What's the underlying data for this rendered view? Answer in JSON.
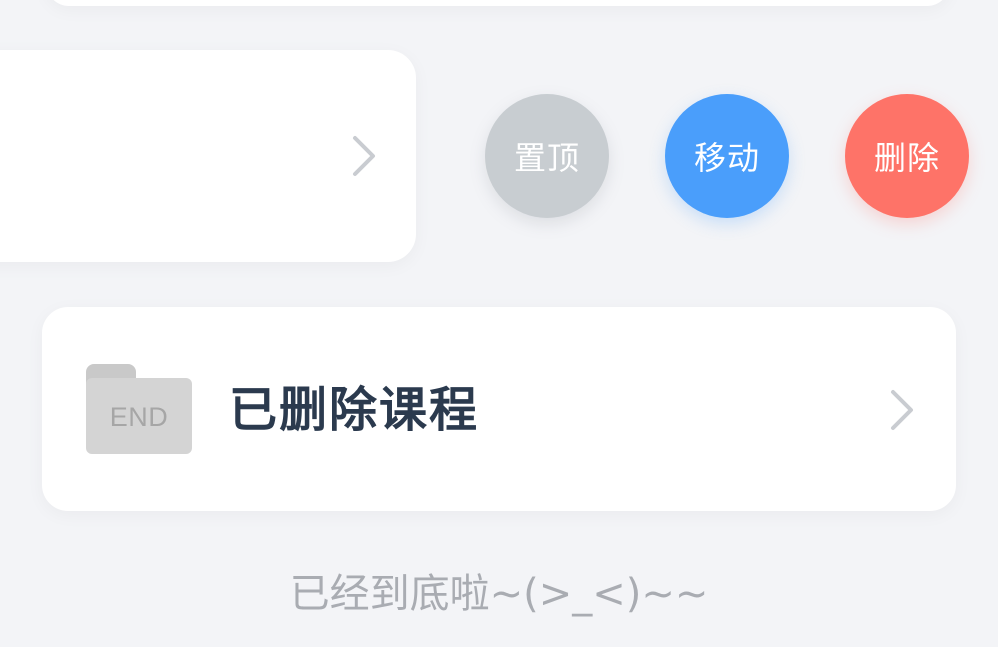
{
  "swiped_item": {
    "actions": [
      {
        "label": "置顶",
        "color": "#c8cdd1"
      },
      {
        "label": "移动",
        "color": "#4a9efb"
      },
      {
        "label": "删除",
        "color": "#fe7368"
      }
    ]
  },
  "deleted_folder": {
    "icon": "folder-icon",
    "icon_label": "END",
    "title": "已删除课程"
  },
  "footer": {
    "end_text": "已经到底啦~(>_<)~~"
  },
  "colors": {
    "background": "#f3f4f7",
    "card": "#ffffff",
    "title": "#2b3a4e",
    "footer": "#a9acb2",
    "chevron": "#c9ccd1"
  }
}
